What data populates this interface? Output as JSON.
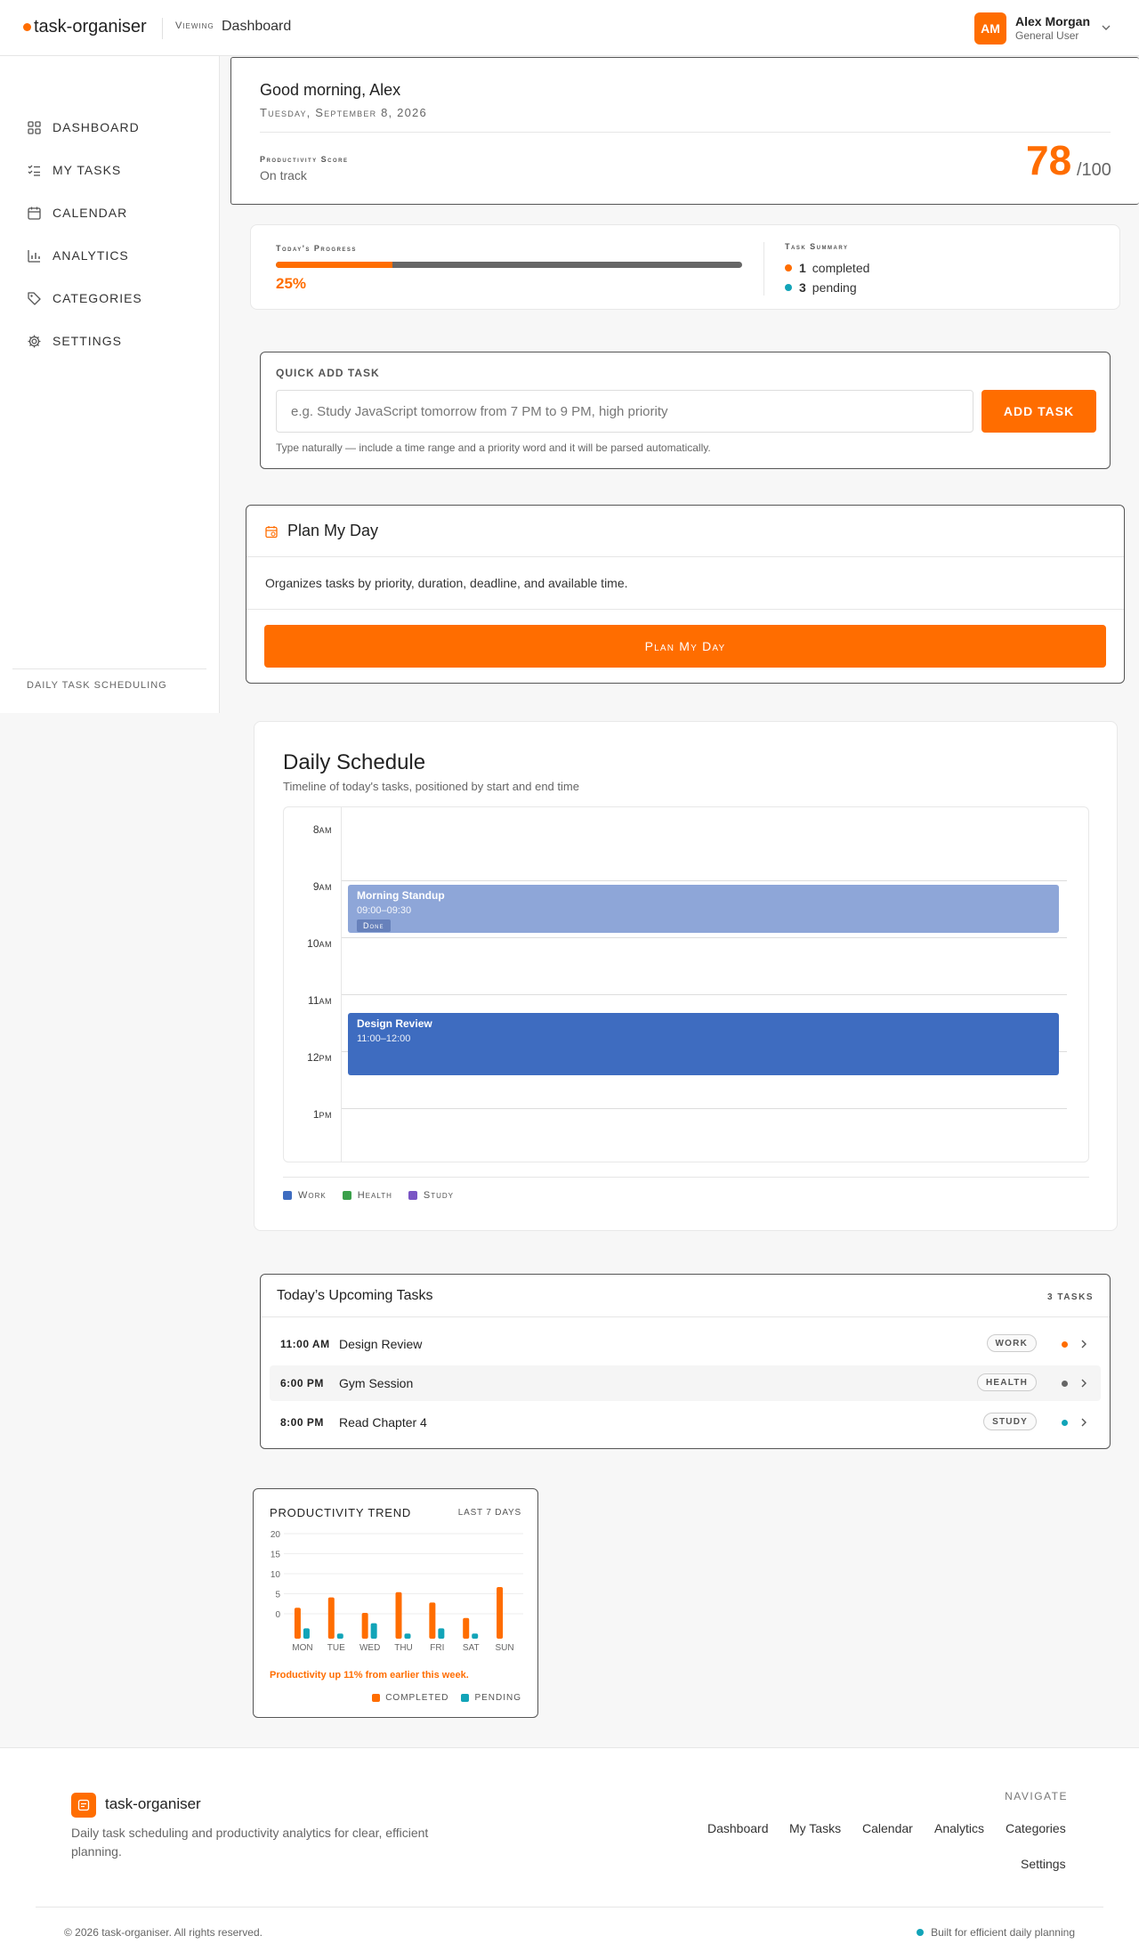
{
  "header": {
    "brand": "task-organiser",
    "viewing_label": "Viewing",
    "viewing_page": "Dashboard",
    "user": {
      "initials": "AM",
      "name": "Alex Morgan",
      "role": "General User"
    }
  },
  "sidebar": {
    "items": [
      {
        "label": "DASHBOARD",
        "icon": "grid-icon"
      },
      {
        "label": "MY TASKS",
        "icon": "checklist-icon"
      },
      {
        "label": "CALENDAR",
        "icon": "calendar-icon"
      },
      {
        "label": "ANALYTICS",
        "icon": "bar-chart-icon"
      },
      {
        "label": "CATEGORIES",
        "icon": "tag-icon"
      },
      {
        "label": "SETTINGS",
        "icon": "gear-icon"
      }
    ],
    "footer": "DAILY TASK SCHEDULING"
  },
  "greeting": {
    "title": "Good morning, Alex",
    "date": "Tuesday, September 8, 2026",
    "score_label": "Productivity Score",
    "score_status": "On track",
    "score_value": "78",
    "score_max": "/100"
  },
  "progress": {
    "label": "Today's Progress",
    "percent_text": "25%",
    "percent_value": 0.25,
    "summary_label": "Task Summary",
    "completed_count": "1",
    "completed_label": "completed",
    "pending_count": "3",
    "pending_label": "pending"
  },
  "quick_add": {
    "title": "QUICK ADD TASK",
    "placeholder": "e.g. Study JavaScript tomorrow from 7 PM to 9 PM, high priority",
    "button": "ADD TASK",
    "hint": "Type naturally — include a time range and a priority word and it will be parsed automatically."
  },
  "plan": {
    "title": "Plan My Day",
    "description": "Organizes tasks by priority, duration, deadline, and available time.",
    "button": "Plan My Day"
  },
  "schedule": {
    "title": "Daily Schedule",
    "subtitle": "Timeline of today's tasks, positioned by start and end time",
    "hours": [
      {
        "num": "8",
        "ampm": "AM"
      },
      {
        "num": "9",
        "ampm": "AM"
      },
      {
        "num": "10",
        "ampm": "AM"
      },
      {
        "num": "11",
        "ampm": "AM"
      },
      {
        "num": "12",
        "ampm": "PM"
      },
      {
        "num": "1",
        "ampm": "PM"
      }
    ],
    "events": [
      {
        "title": "Morning Standup",
        "time": "09:00–09:30",
        "badge": "Done",
        "start_hour": 9.0,
        "end_hour": 9.85,
        "color": "#8ea6d8"
      },
      {
        "title": "Design Review",
        "time": "11:00–12:00",
        "badge": "",
        "start_hour": 11.25,
        "end_hour": 12.35,
        "color": "#3e6cc0"
      }
    ],
    "legend": [
      {
        "label": "Work",
        "color": "#3e6cc0"
      },
      {
        "label": "Health",
        "color": "#3aa04a"
      },
      {
        "label": "Study",
        "color": "#7a55c4"
      }
    ]
  },
  "upcoming": {
    "title": "Today’s Upcoming Tasks",
    "count": "3 TASKS",
    "tasks": [
      {
        "time": "11:00 AM",
        "name": "Design Review",
        "tag": "WORK",
        "dot": "#ff6d00"
      },
      {
        "time": "6:00 PM",
        "name": "Gym Session",
        "tag": "HEALTH",
        "dot": "#666666"
      },
      {
        "time": "8:00 PM",
        "name": "Read Chapter 4",
        "tag": "STUDY",
        "dot": "#12a4b8"
      }
    ]
  },
  "trend": {
    "title": "PRODUCTIVITY TREND",
    "range": "LAST 7 DAYS",
    "note": "Productivity up 11% from earlier this week.",
    "legend_completed": "COMPLETED",
    "legend_pending": "PENDING",
    "colors": {
      "completed": "#ff6d00",
      "pending": "#12a4b8"
    }
  },
  "chart_data": {
    "type": "bar",
    "title": "PRODUCTIVITY TREND",
    "categories": [
      "MON",
      "TUE",
      "WED",
      "THU",
      "FRI",
      "SAT",
      "SUN"
    ],
    "series": [
      {
        "name": "COMPLETED",
        "values": [
          6,
          8,
          5,
          9,
          7,
          4,
          10
        ]
      },
      {
        "name": "PENDING",
        "values": [
          2,
          1,
          3,
          1,
          2,
          1,
          0
        ]
      }
    ],
    "yticks": [
      "20",
      "15",
      "10",
      "5",
      "0"
    ],
    "ylim": [
      0,
      20
    ],
    "grid": true,
    "legend": "bottom-right"
  },
  "footer": {
    "brand": "task-organiser",
    "description": "Daily task scheduling and productivity analytics for clear, efficient planning.",
    "nav_label": "NAVIGATE",
    "links": [
      "Dashboard",
      "My Tasks",
      "Calendar",
      "Analytics",
      "Categories",
      "Settings"
    ],
    "copyright": "© 2026 task-organiser. All rights reserved.",
    "built": "Built for efficient daily planning"
  }
}
